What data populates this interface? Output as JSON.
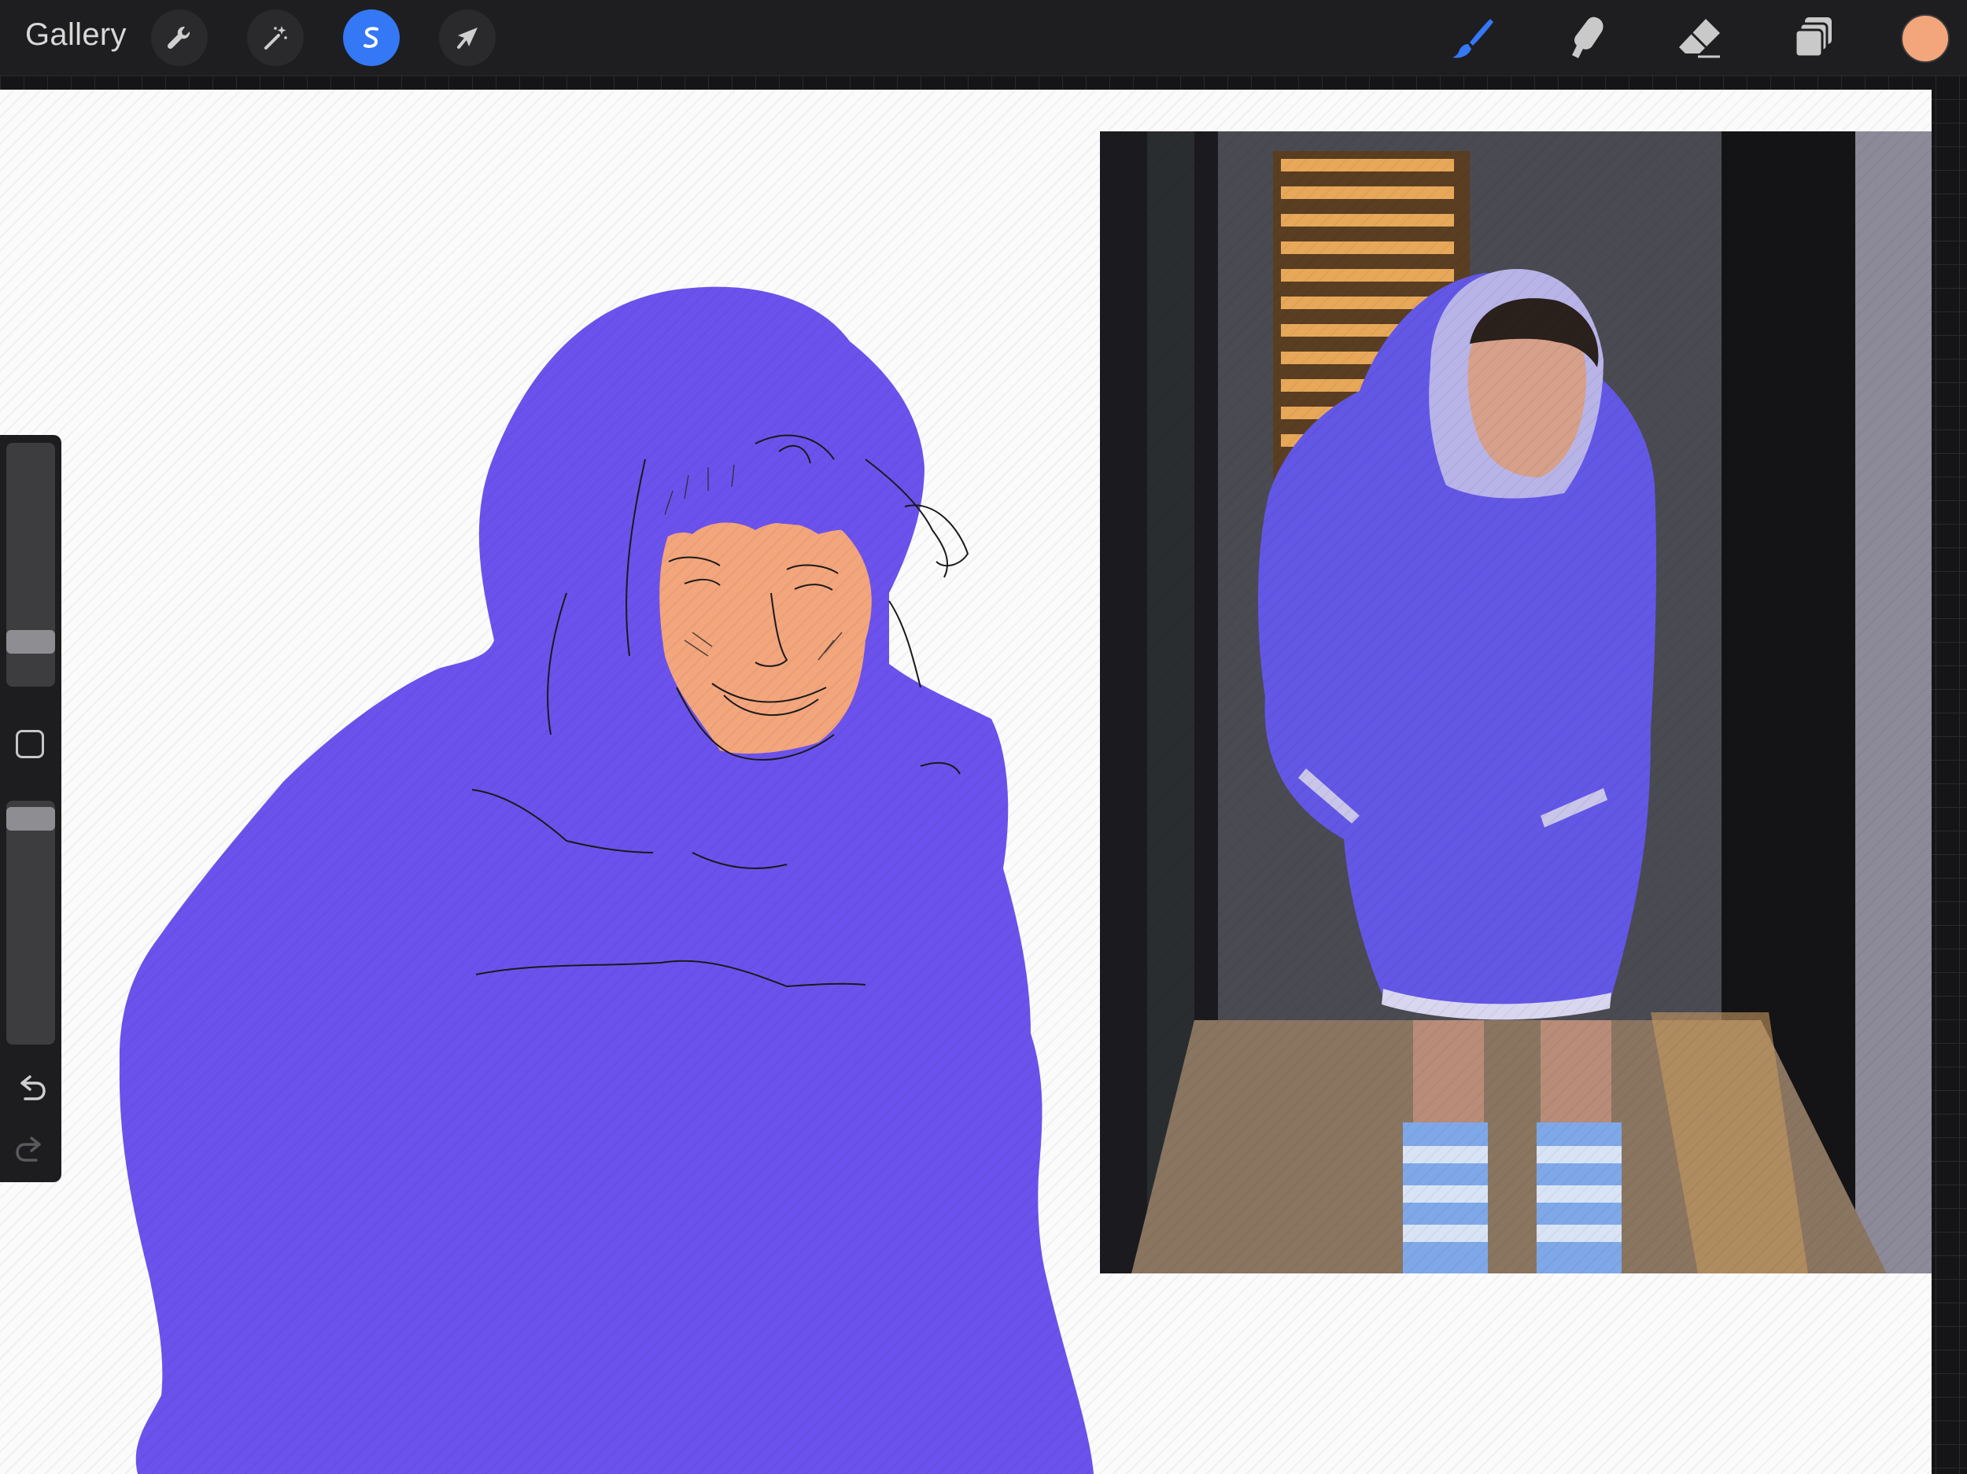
{
  "topbar": {
    "gallery_label": "Gallery",
    "left_tools": [
      {
        "name": "actions",
        "icon": "wrench-icon",
        "active": false
      },
      {
        "name": "adjustments",
        "icon": "magic-wand-icon",
        "active": false
      },
      {
        "name": "selection",
        "icon": "selection-s-icon",
        "active": true
      },
      {
        "name": "transform",
        "icon": "arrow-cursor-icon",
        "active": false
      }
    ],
    "right_tools": [
      {
        "name": "brush",
        "icon": "brush-icon",
        "active": true,
        "color": "#3478f6"
      },
      {
        "name": "smudge",
        "icon": "smudge-finger-icon",
        "active": false
      },
      {
        "name": "eraser",
        "icon": "eraser-icon",
        "active": false
      },
      {
        "name": "layers",
        "icon": "layers-icon",
        "active": false
      }
    ],
    "current_color": "#f3a57c"
  },
  "sidebar": {
    "brush_size_level": 0.15,
    "opacity_level": 0.97,
    "modify_icon": "square-modify-icon",
    "undo_icon": "undo-icon",
    "redo_icon": "redo-icon",
    "redo_enabled": false
  },
  "canvas": {
    "background": "#fbfbfb",
    "fill_color": "#6c52ec",
    "skin_color": "#f3a57c"
  }
}
